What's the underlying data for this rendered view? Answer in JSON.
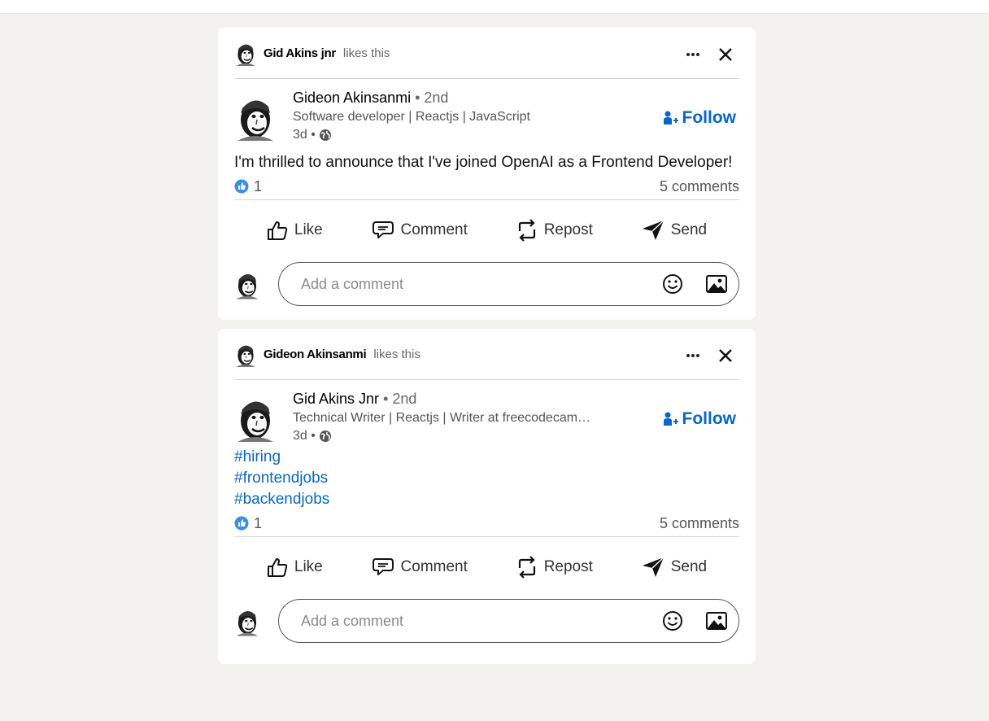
{
  "posts": [
    {
      "social_name": "Gid Akins jnr",
      "social_action": "likes this",
      "author_name": "Gideon Akinsanmi",
      "author_degree": "• 2nd",
      "author_headline": "Software developer | Reactjs | JavaScript",
      "time": "3d •",
      "follow_label": "Follow",
      "text": "I'm thrilled to announce that I've joined OpenAI as a Frontend Developer!",
      "hashtags": [],
      "reactions_count": "1",
      "comments_count": "5 comments",
      "actions": {
        "like": "Like",
        "comment": "Comment",
        "repost": "Repost",
        "send": "Send"
      },
      "comment_placeholder": "Add a comment"
    },
    {
      "social_name": "Gideon Akinsanmi",
      "social_action": "likes this",
      "author_name": "Gid Akins Jnr",
      "author_degree": "• 2nd",
      "author_headline": "Technical Writer | Reactjs | Writer at freecodecam…",
      "time": "3d •",
      "follow_label": "Follow",
      "text": "",
      "hashtags": [
        "#hiring",
        "#frontendjobs",
        "#backendjobs"
      ],
      "reactions_count": "1",
      "comments_count": "5 comments",
      "actions": {
        "like": "Like",
        "comment": "Comment",
        "repost": "Repost",
        "send": "Send"
      },
      "comment_placeholder": "Add a comment"
    }
  ],
  "colors": {
    "accent": "#0a66c2",
    "background": "#f3f2ef",
    "card": "#ffffff"
  },
  "icons": [
    "avatar-photo",
    "more-icon",
    "close-icon",
    "follow-icon",
    "globe-icon",
    "like-reaction-icon",
    "like-icon",
    "comment-icon",
    "repost-icon",
    "send-icon",
    "emoji-icon",
    "image-icon"
  ]
}
